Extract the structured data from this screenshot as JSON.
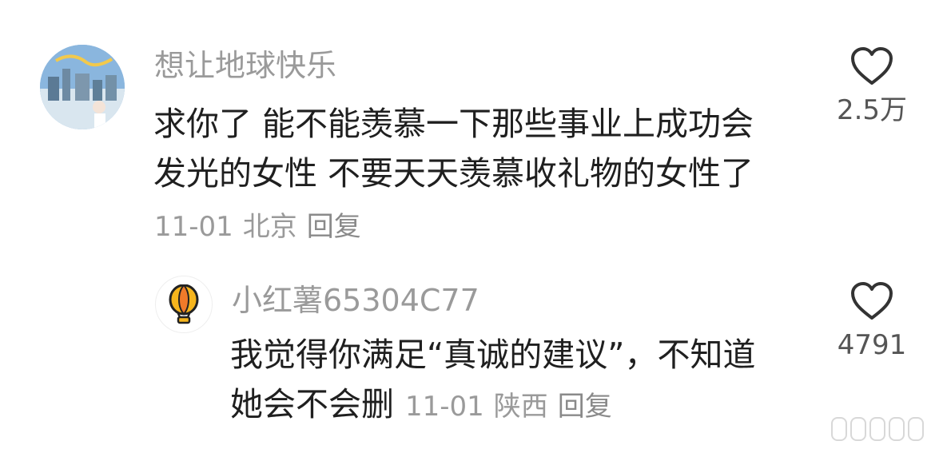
{
  "comment": {
    "username": "想让地球快乐",
    "content_lines": [
      "求你了 能不能羡慕一下那些事业上成功会",
      "发光的女性 不要天天羡慕收礼物的女性了"
    ],
    "date": "11-01",
    "location": "北京",
    "reply_label": "回复",
    "like_count": "2.5万",
    "avatar_icon": "avatar-photo-icon"
  },
  "reply": {
    "username": "小红薯65304C77",
    "content_lines": [
      "我觉得你满足“真诚的建议”，不知道",
      "她会不会删"
    ],
    "date": "11-01",
    "location": "陕西",
    "reply_label": "回复",
    "like_count": "4791",
    "avatar_icon": "hot-air-balloon-icon"
  },
  "colors": {
    "text": "#1f1f1f",
    "meta": "#9a9a9a",
    "background": "#ffffff"
  }
}
